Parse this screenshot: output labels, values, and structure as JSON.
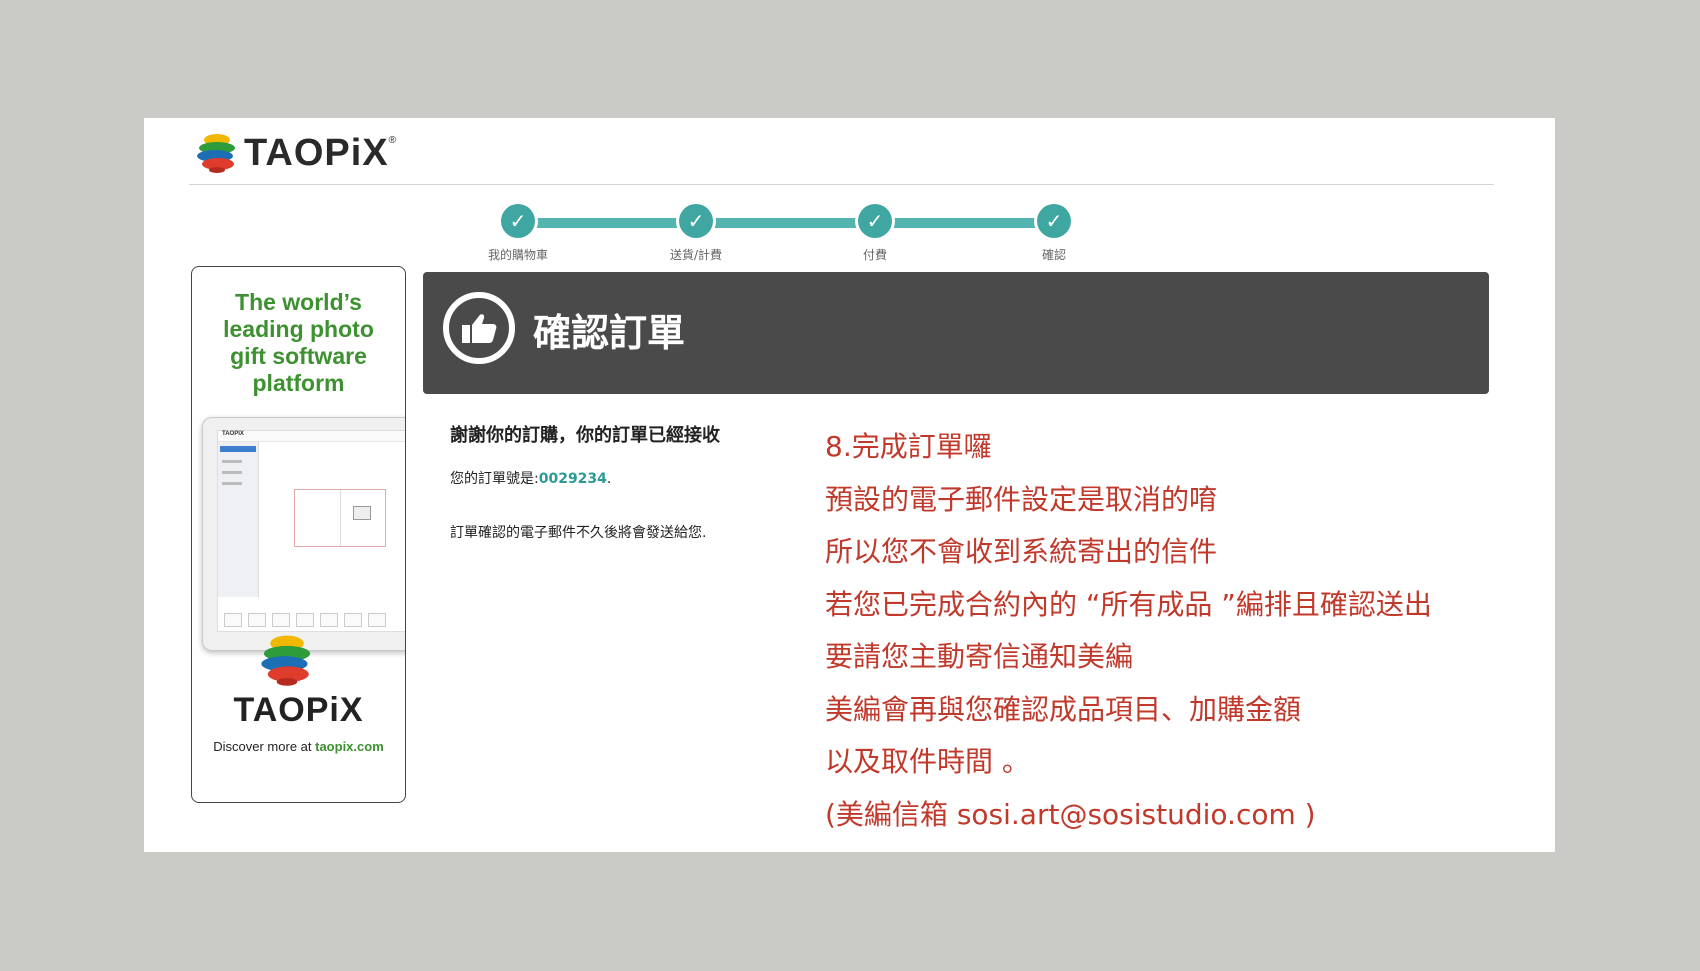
{
  "header": {
    "brand": "TAOPiX",
    "brand_mark": "®"
  },
  "progress": {
    "steps": [
      {
        "label": "我的購物車",
        "done": true
      },
      {
        "label": "送貨/計費",
        "done": true
      },
      {
        "label": "付費",
        "done": true
      },
      {
        "label": "確認",
        "done": true
      }
    ],
    "check_icon": "✓",
    "color": "#3fa6a2"
  },
  "ad": {
    "tagline": [
      "The world’s",
      "leading photo",
      "gift software",
      "platform"
    ],
    "brand": "TAOPiX",
    "discover_prefix": "Discover more at ",
    "discover_link": "taopix.com",
    "tablet_logo": "TAOPIX"
  },
  "banner": {
    "title": "確認訂單",
    "icon": "thumbs-up-icon"
  },
  "confirmation": {
    "thanks": "謝謝你的訂購，你的訂單已經接收",
    "order_prefix": "您的訂單號是:",
    "order_number": "0029234",
    "order_suffix": ".",
    "email_note": "訂單確認的電子郵件不久後將會發送給您."
  },
  "annotation": {
    "lines": [
      "8.完成訂單囉",
      "預設的電子郵件設定是取消的唷",
      "所以您不會收到系統寄出的信件",
      "若您已完成合約內的 “所有成品 ”編排且確認送出",
      "要請您主動寄信通知美編",
      "美編會再與您確認成品項目、加購金額",
      "以及取件時間 。",
      "(美編信箱  sosi.art@sosistudio.com )"
    ],
    "color": "#c0392b"
  }
}
